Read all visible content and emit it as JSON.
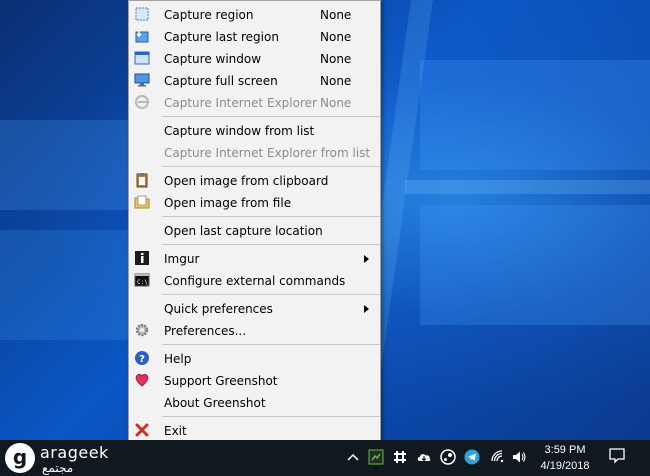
{
  "menu": {
    "items": [
      {
        "label": "Capture region",
        "shortcut": "None",
        "icon": "capture-region-icon",
        "enabled": true
      },
      {
        "label": "Capture last region",
        "shortcut": "None",
        "icon": "capture-last-region-icon",
        "enabled": true
      },
      {
        "label": "Capture window",
        "shortcut": "None",
        "icon": "capture-window-icon",
        "enabled": true
      },
      {
        "label": "Capture full screen",
        "shortcut": "None",
        "icon": "capture-full-screen-icon",
        "enabled": true
      },
      {
        "label": "Capture Internet Explorer",
        "shortcut": "None",
        "icon": "internet-explorer-icon",
        "enabled": false
      },
      {
        "label": "Capture window from list",
        "enabled": true
      },
      {
        "label": "Capture Internet Explorer from list",
        "enabled": false
      },
      {
        "label": "Open image from clipboard",
        "icon": "clipboard-icon",
        "enabled": true
      },
      {
        "label": "Open image from file",
        "icon": "folder-icon",
        "enabled": true
      },
      {
        "label": "Open last capture location",
        "enabled": true
      },
      {
        "label": "Imgur",
        "icon": "imgur-icon",
        "enabled": true,
        "submenu": true
      },
      {
        "label": "Configure external commands",
        "icon": "command-prompt-icon",
        "enabled": true
      },
      {
        "label": "Quick preferences",
        "enabled": true,
        "submenu": true
      },
      {
        "label": "Preferences...",
        "icon": "gear-icon",
        "enabled": true
      },
      {
        "label": "Help",
        "icon": "help-icon",
        "enabled": true
      },
      {
        "label": "Support Greenshot",
        "icon": "heart-icon",
        "enabled": true
      },
      {
        "label": "About Greenshot",
        "enabled": true
      },
      {
        "label": "Exit",
        "icon": "exit-x-icon",
        "enabled": true
      }
    ]
  },
  "brand": {
    "letter": "g",
    "name": "arageek",
    "arabic": "مجتمع"
  },
  "taskbar": {
    "time": "3:59 PM",
    "date": "4/19/2018",
    "tray_icons": [
      "chevron-up-icon",
      "greenshot-icon",
      "slack-icon",
      "cloud-icon",
      "steam-icon",
      "telegram-icon",
      "wifi-icon",
      "speaker-icon",
      "notification-icon"
    ]
  },
  "colors": {
    "menu_bg": "#f2f2f2",
    "disabled_text": "#8c8c8c",
    "taskbar_bg": "#101820",
    "accent_blue": "#0a56c4"
  }
}
